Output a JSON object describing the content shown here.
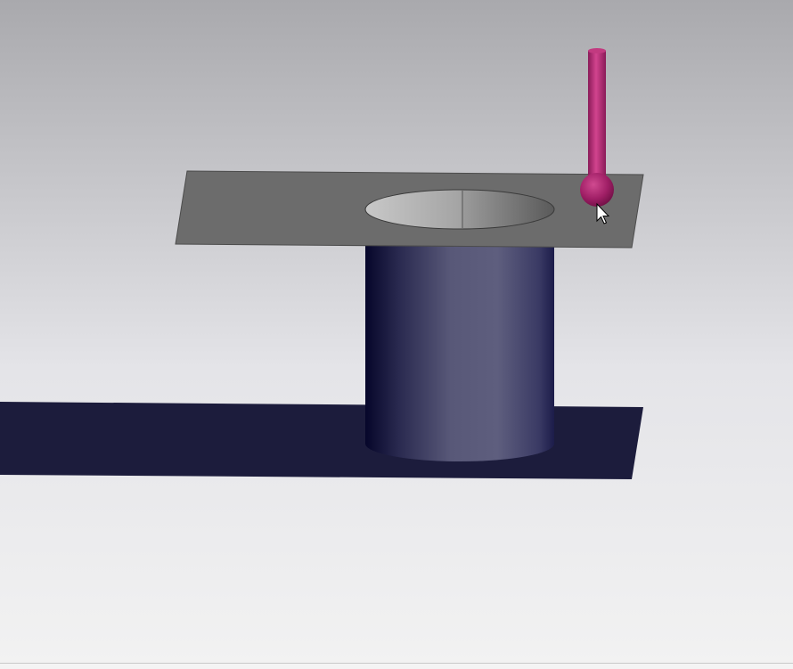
{
  "scene": {
    "background_top_color": "#a9a9ad",
    "background_bottom_color": "#f2f2f2",
    "objects": [
      {
        "name": "top-plate",
        "material_color": "#6c6c6c"
      },
      {
        "name": "circular-aperture",
        "material_color": "#b9b9b9"
      },
      {
        "name": "cylinder",
        "material_color": "#5a5a78"
      },
      {
        "name": "ground-plane",
        "material_color": "#1c1c3c"
      },
      {
        "name": "probe",
        "material_color": "#b22a78"
      }
    ]
  },
  "cursor": {
    "icon": "arrow-cursor-icon"
  }
}
